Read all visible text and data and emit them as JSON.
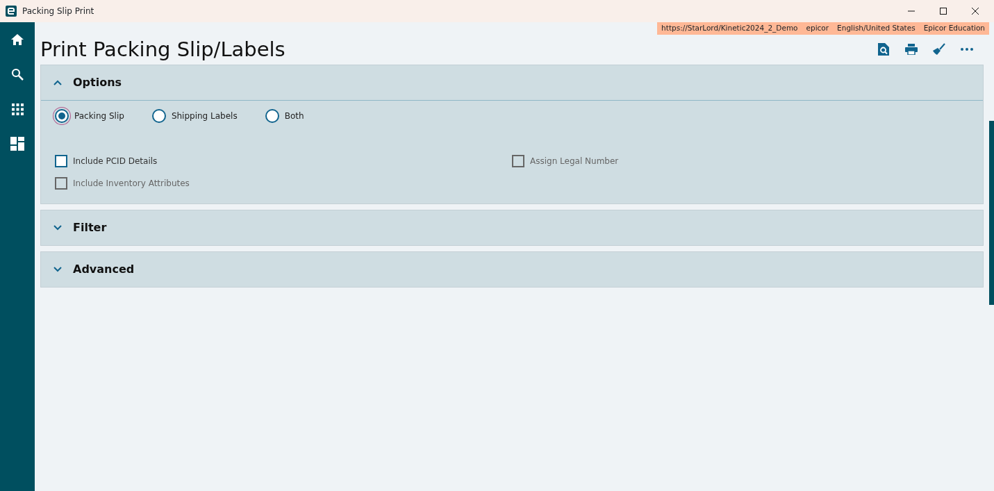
{
  "window": {
    "title": "Packing Slip Print"
  },
  "info_bar": [
    "https://StarLord/Kinetic2024_2_Demo",
    "epicor",
    "English/United States",
    "Epicor Education"
  ],
  "page_title": "Print Packing Slip/Labels",
  "sections": [
    {
      "title": "Options",
      "expanded": true,
      "radios": [
        {
          "label": "Packing Slip",
          "selected": true
        },
        {
          "label": "Shipping Labels",
          "selected": false
        },
        {
          "label": "Both",
          "selected": false
        }
      ],
      "checkbox_columns": [
        [
          {
            "label": "Include PCID Details",
            "checked": false,
            "disabled": false
          },
          {
            "label": "Include Inventory Attributes",
            "checked": false,
            "disabled": true
          }
        ],
        [
          {
            "label": "Assign Legal Number",
            "checked": false,
            "disabled": true
          }
        ]
      ]
    },
    {
      "title": "Filter",
      "expanded": false
    },
    {
      "title": "Advanced",
      "expanded": false
    }
  ]
}
